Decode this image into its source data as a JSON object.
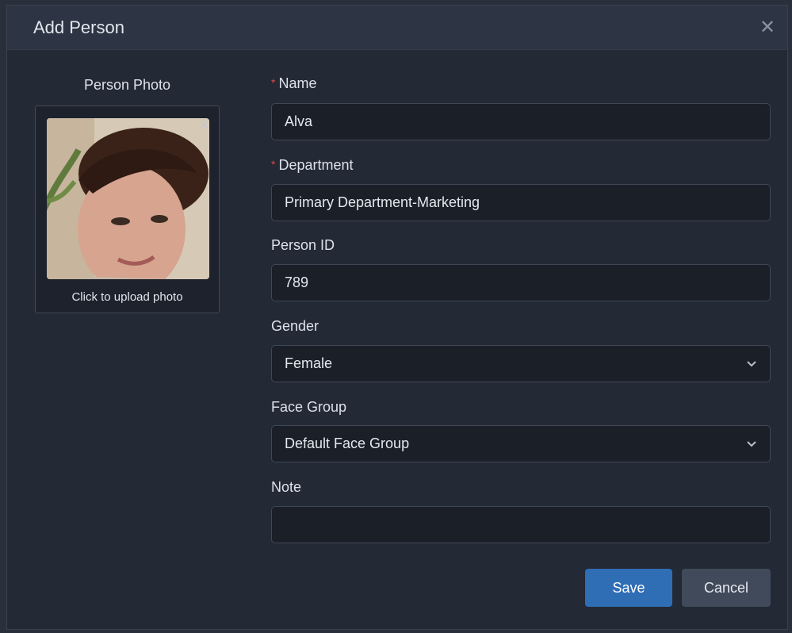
{
  "dialog": {
    "title": "Add Person",
    "close_icon": "close-icon"
  },
  "photo": {
    "label": "Person Photo",
    "upload_text": "Click to upload photo",
    "remove_icon": "close-icon"
  },
  "form": {
    "name": {
      "label": "Name",
      "required": true,
      "value": "Alva"
    },
    "department": {
      "label": "Department",
      "required": true,
      "value": "Primary Department-Marketing"
    },
    "person_id": {
      "label": "Person ID",
      "value": "789"
    },
    "gender": {
      "label": "Gender",
      "value": "Female",
      "icon": "chevron-down-icon"
    },
    "face_group": {
      "label": "Face Group",
      "value": "Default Face Group",
      "icon": "chevron-down-icon"
    },
    "note": {
      "label": "Note",
      "value": ""
    }
  },
  "buttons": {
    "save": "Save",
    "cancel": "Cancel"
  },
  "colors": {
    "primary": "#2f6db5",
    "required": "#d8494a",
    "background": "#232935"
  }
}
